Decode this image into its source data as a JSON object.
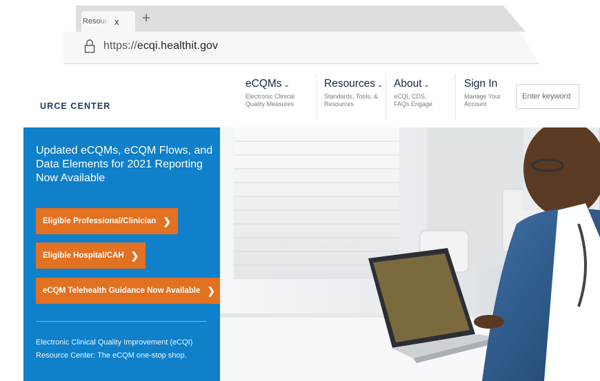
{
  "browser": {
    "tab": {
      "title": "Resource Center",
      "close_label": "x",
      "new_tab_label": "+"
    },
    "address": {
      "scheme": "https://",
      "host": "ecqi.healthit.gov"
    },
    "icons": {
      "lock": "lock-icon",
      "close": "close-icon",
      "new_tab": "plus-icon"
    }
  },
  "header": {
    "logo_text": "URCE CENTER",
    "nav": [
      {
        "title": "eCQMs",
        "caret": "⌄",
        "subtitle": "Electronic Clinical Quality Measures"
      },
      {
        "title": "Resources",
        "caret": "⌄",
        "subtitle": "Standards, Tools, & Resources"
      },
      {
        "title": "About",
        "caret": "⌄",
        "subtitle": "eCQI, CDS, FAQs Engage"
      },
      {
        "title": "Sign In",
        "caret": "",
        "subtitle": "Manage Your Account"
      }
    ],
    "search": {
      "placeholder": "Enter keyword"
    }
  },
  "hero": {
    "headline": "Updated eCQMs, eCQM Flows, and Data Elements for 2021 Reporting Now Available",
    "buttons": [
      {
        "label": "Eligible Professional/Clinician",
        "chevron": "❯"
      },
      {
        "label": "Eligible Hospital/CAH",
        "chevron": "❯"
      },
      {
        "label": "eCQM Telehealth Guidance Now Available",
        "chevron": "❯"
      }
    ],
    "description": "Electronic Clinical Quality Improvement (eCQI) Resource Center: The eCQM one-stop shop."
  },
  "colors": {
    "hero_blue": "#0f80c9",
    "button_orange": "#e27121",
    "nav_text": "#13263f",
    "logo_navy": "#1c3a5e"
  }
}
